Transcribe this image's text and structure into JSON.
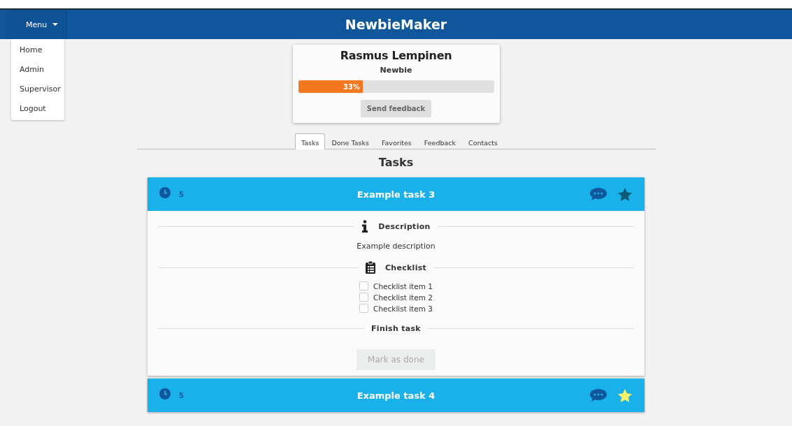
{
  "header": {
    "title": "NewbieMaker",
    "menu_button": "Menu"
  },
  "menu": {
    "expanded": true,
    "items": [
      "Home",
      "Admin",
      "Supervisor",
      "Logout"
    ]
  },
  "profile": {
    "name": "Rasmus Lempinen",
    "role": "Newbie",
    "level": 0.33,
    "progress_label": "33%",
    "button": "Send feedback"
  },
  "tabs": [
    {
      "label": "Tasks",
      "selected": true
    },
    {
      "label": "Done Tasks",
      "selected": false
    },
    {
      "label": "Favorites",
      "selected": false
    },
    {
      "label": "Feedback",
      "selected": false
    },
    {
      "label": "Contacts",
      "selected": false
    }
  ],
  "heading": "Tasks",
  "tasks": [
    {
      "duration": "5",
      "title": "Example task 3",
      "favorite": false,
      "expanded": true,
      "description_heading": "Description",
      "description": "Example description",
      "checklist_heading": "Checklist",
      "checklist": [
        {
          "label": "Checklist item 1",
          "checked": false
        },
        {
          "label": "Checklist item 2",
          "checked": false
        },
        {
          "label": "Checklist item 3",
          "checked": false
        }
      ],
      "finish_heading": "Finish task",
      "done_button": {
        "label": "Mark as done",
        "disabled": true
      }
    },
    {
      "duration": "5",
      "title": "Example task 4",
      "favorite": true,
      "expanded": false
    }
  ]
}
